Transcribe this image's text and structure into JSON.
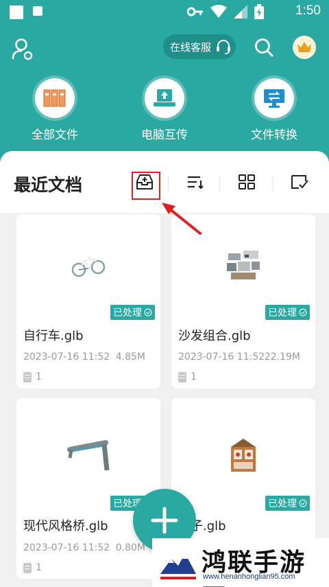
{
  "status_bar": {
    "time": "1:50"
  },
  "header": {
    "service_label": "在线客服",
    "features": [
      {
        "label": "全部文件",
        "icon": "folder-binders-icon"
      },
      {
        "label": "电脑互传",
        "icon": "laptop-transfer-icon"
      },
      {
        "label": "文件转换",
        "icon": "monitor-convert-icon"
      }
    ]
  },
  "recent": {
    "title": "最近文档",
    "files": [
      {
        "name": "自行车.glb",
        "date": "2023-07-16 11:52",
        "size": "4.85M",
        "pages": "1",
        "badge": "已处理"
      },
      {
        "name": "沙发组合.glb",
        "date": "2023-07-16 11:52",
        "size": "22.19M",
        "pages": "1",
        "badge": "已处理"
      },
      {
        "name": "现代风格桥.glb",
        "date": "2023-07-16 11:52",
        "size": "0.80M",
        "pages": "1",
        "badge": "已处理"
      },
      {
        "name": "柜子.glb",
        "date": "",
        "size": "",
        "pages": "",
        "badge": "已处理"
      }
    ]
  },
  "watermark": {
    "title": "鸿联手游网",
    "url": "www.henanhonglian95.com"
  },
  "colors": {
    "accent": "#2aa9a3",
    "highlight": "#e02020"
  }
}
